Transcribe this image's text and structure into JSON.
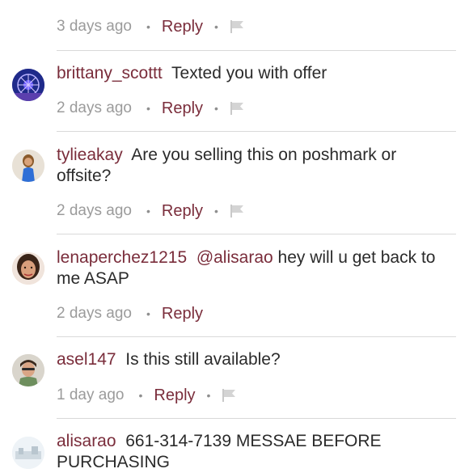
{
  "comments": [
    {
      "user": "",
      "text": "",
      "time": "3 days ago",
      "reply": "Reply",
      "has_flag": true
    },
    {
      "user": "brittany_scottt",
      "text": "Texted you with offer",
      "time": "2 days ago",
      "reply": "Reply",
      "has_flag": true
    },
    {
      "user": "tylieakay",
      "text": "Are you selling this on poshmark or offsite?",
      "time": "2 days ago",
      "reply": "Reply",
      "has_flag": true
    },
    {
      "user": "lenaperchez1215",
      "mention": "@alisarao",
      "text": "hey will u get back to me ASAP",
      "time": "2 days ago",
      "reply": "Reply",
      "has_flag": false
    },
    {
      "user": "asel147",
      "text": "Is this still available?",
      "time": "1 day ago",
      "reply": "Reply",
      "has_flag": true
    },
    {
      "user": "alisarao",
      "text": "661-314-7139 MESSAE BEFORE PURCHASING",
      "time": "",
      "reply": "",
      "has_flag": false
    }
  ],
  "colors": {
    "accent": "#7a2d3b",
    "meta": "#9b9b9b",
    "divider": "#d9d9d9"
  },
  "icons": {
    "flag": "flag-icon",
    "separator": "dot-separator"
  }
}
